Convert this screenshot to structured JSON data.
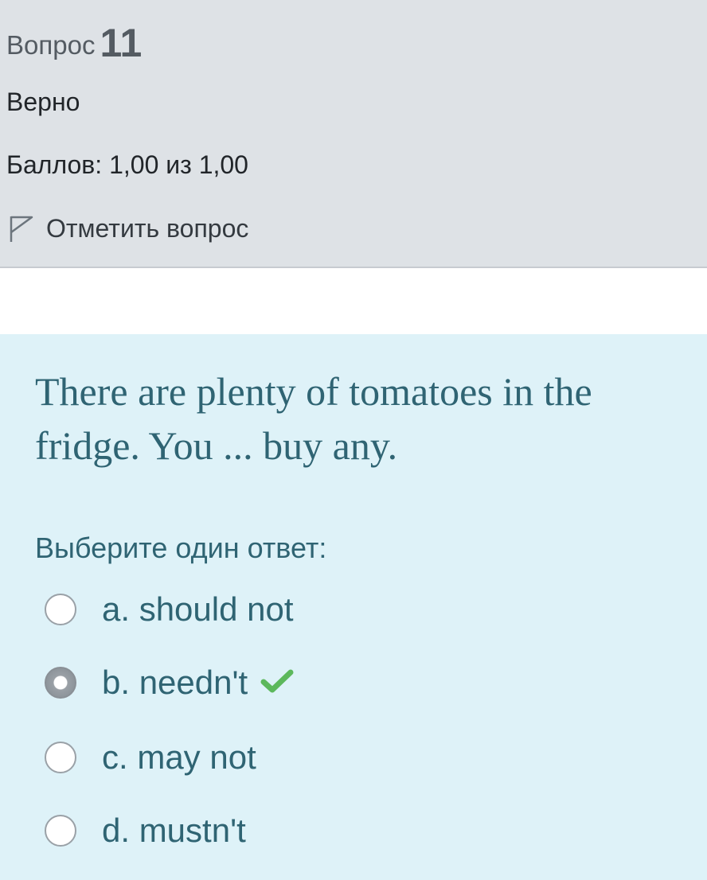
{
  "info": {
    "question_word": "Вопрос",
    "question_number": "11",
    "state": "Верно",
    "grade": "Баллов: 1,00 из 1,00",
    "flag_label": "Отметить вопрос",
    "flag_icon": "flag-outline-icon"
  },
  "question": {
    "text": "There are plenty of tomatoes in the fridge. You ... buy any.",
    "prompt": "Выберите один ответ:",
    "answers": [
      {
        "label": "a. should not",
        "selected": false,
        "correct": false
      },
      {
        "label": "b. needn't",
        "selected": true,
        "correct": true
      },
      {
        "label": "c. may not",
        "selected": false,
        "correct": false
      },
      {
        "label": "d. mustn't",
        "selected": false,
        "correct": false
      }
    ],
    "correct_icon": "check-icon"
  },
  "colors": {
    "info_background": "#dee2e6",
    "content_background": "#def2f8",
    "question_text": "#2f6473",
    "correct_check": "#5cb85c"
  }
}
